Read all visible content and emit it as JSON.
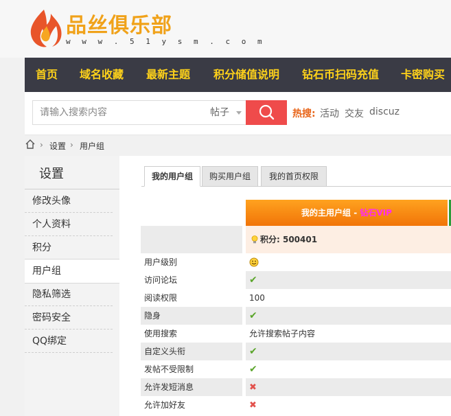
{
  "site": {
    "title": "品丝俱乐部",
    "url": "w w w . 5 1 y s m . c o m"
  },
  "nav": {
    "items": [
      "首页",
      "域名收藏",
      "最新主题",
      "积分储值说明",
      "钻石币扫码充值",
      "卡密购买"
    ]
  },
  "search": {
    "placeholder": "请输入搜索内容",
    "type": "帖子",
    "hot_label": "热搜:",
    "hot_links": [
      "活动",
      "交友",
      "discuz"
    ]
  },
  "breadcrumb": {
    "items": [
      "设置",
      "用户组"
    ]
  },
  "sidebar": {
    "title": "设置",
    "items": [
      "修改头像",
      "个人资料",
      "积分",
      "用户组",
      "隐私筛选",
      "密码安全",
      "QQ绑定"
    ],
    "active": "用户组"
  },
  "tabs": [
    "我的用户组",
    "购买用户组",
    "我的首页权限"
  ],
  "group": {
    "header_prefix": "我的主用户组 - ",
    "header_name": "钻石VIP",
    "credits_label": "积分: 500401"
  },
  "permissions": [
    {
      "label": "用户级别",
      "value": "☺",
      "kind": "smiley"
    },
    {
      "label": "访问论坛",
      "value": "✔",
      "kind": "check"
    },
    {
      "label": "阅读权限",
      "value": "100",
      "kind": "text"
    },
    {
      "label": "隐身",
      "value": "✔",
      "kind": "check"
    },
    {
      "label": "使用搜索",
      "value": "允许搜索帖子内容",
      "kind": "text"
    },
    {
      "label": "自定义头衔",
      "value": "✔",
      "kind": "check"
    },
    {
      "label": "发帖不受限制",
      "value": "✔",
      "kind": "check"
    },
    {
      "label": "允许发短消息",
      "value": "✖",
      "kind": "cross"
    },
    {
      "label": "允许加好友",
      "value": "✖",
      "kind": "cross"
    }
  ],
  "colors": {
    "nav_bg": "#3a3b45",
    "nav_text": "#ffd21a",
    "search_button": "#ef4b4b",
    "header_orange": "#f17408",
    "vip_pink": "#ff2cf0",
    "check_green": "#5aa52a",
    "cross_red": "#e2514c"
  }
}
